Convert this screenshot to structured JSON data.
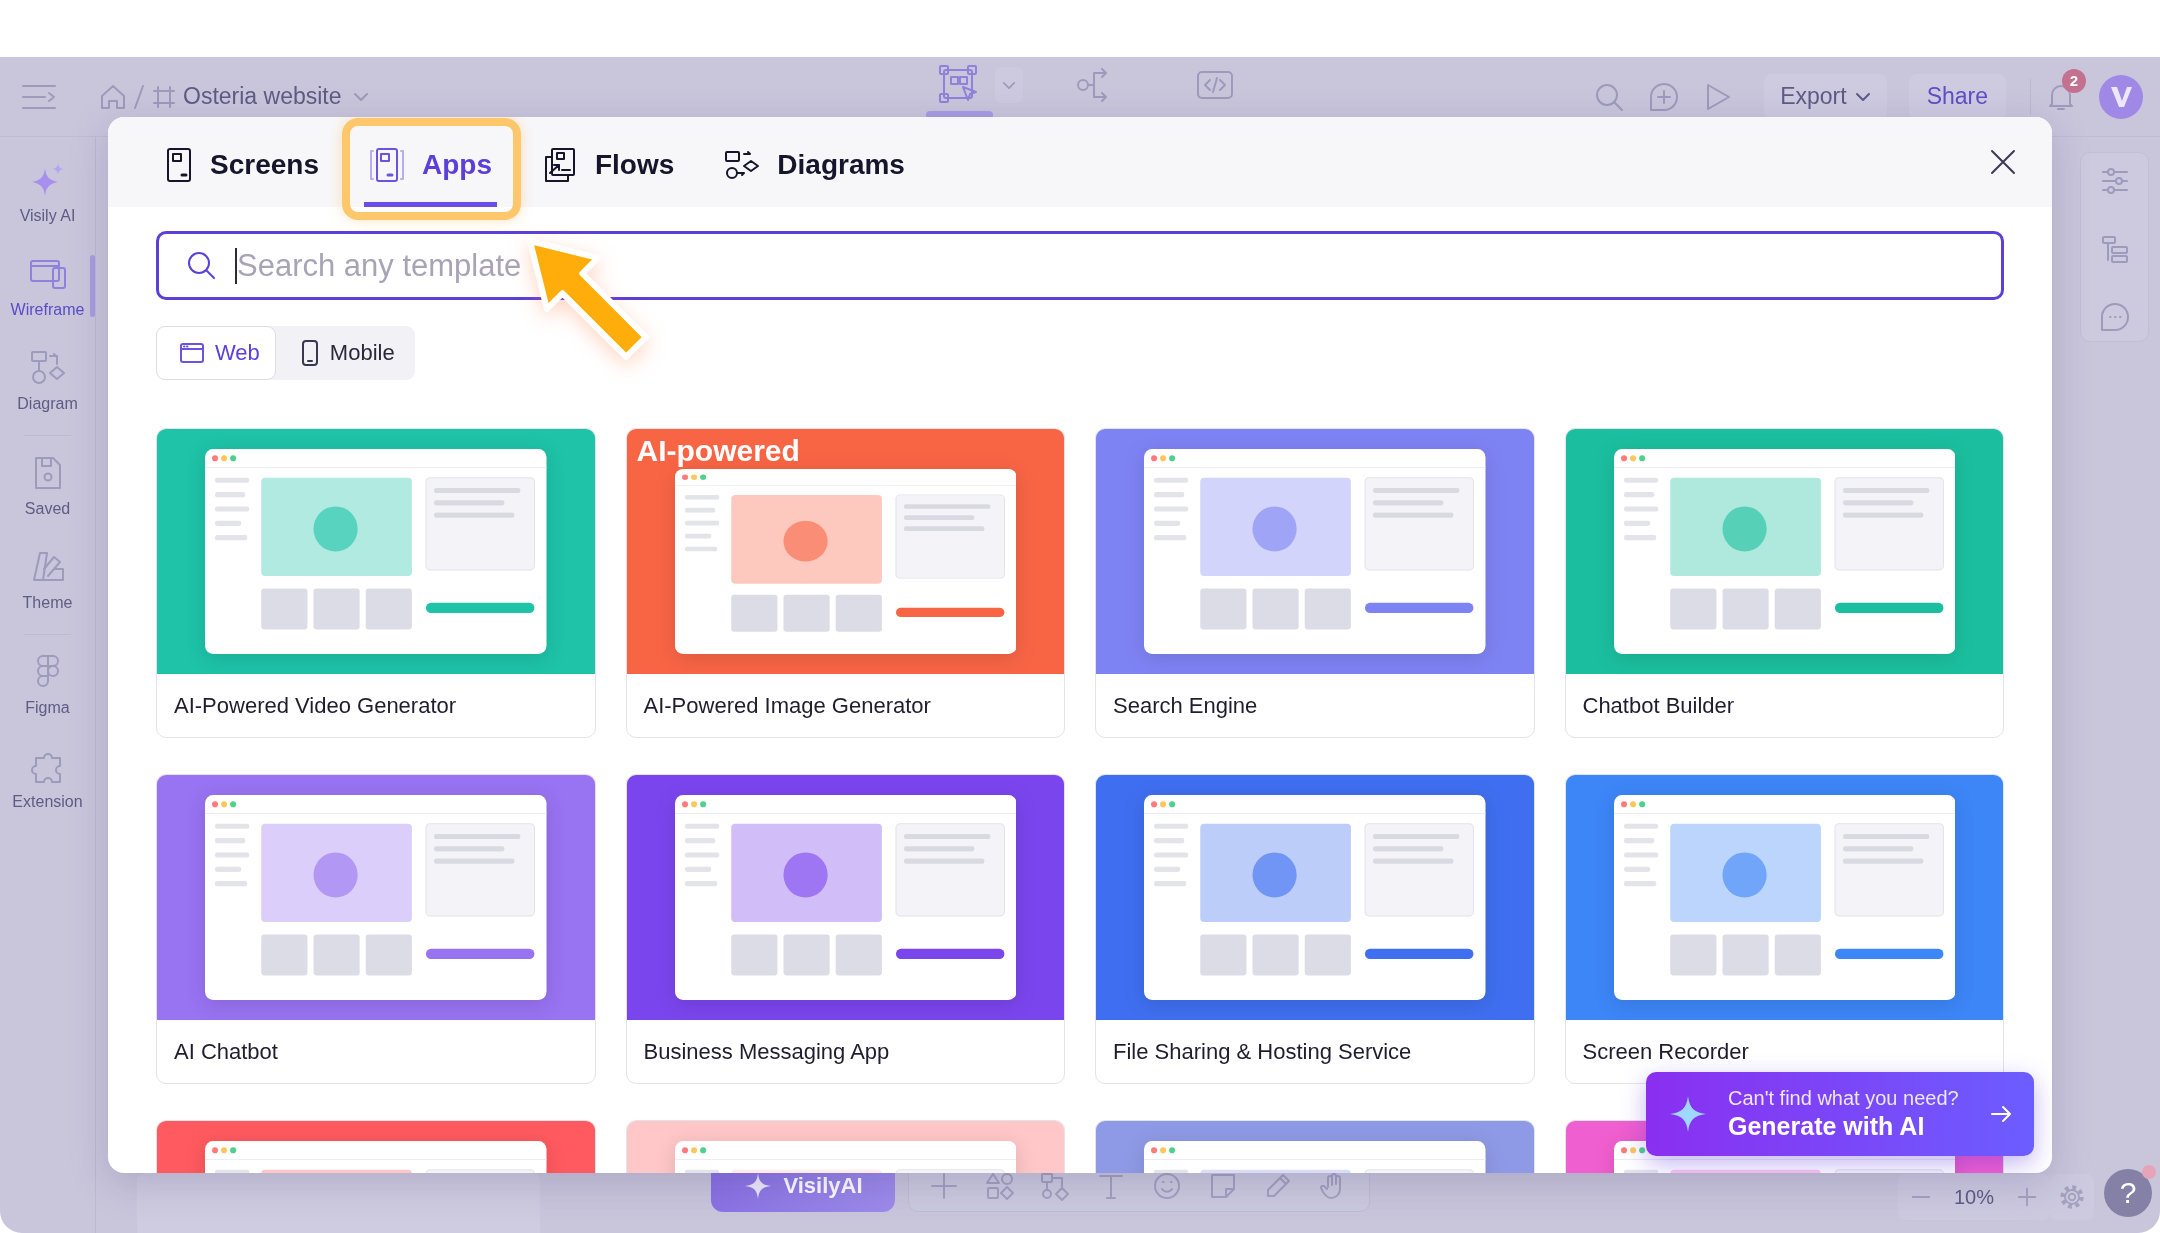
{
  "top_bar": {
    "project": "Osteria website",
    "modes": [
      {
        "kind": "design",
        "selected": true
      },
      {
        "kind": "prototype",
        "selected": false
      },
      {
        "kind": "inspect",
        "selected": false
      }
    ],
    "export": "Export",
    "share": "Share",
    "notification_count": "2"
  },
  "sidebar": {
    "groups": [
      {
        "items": [
          {
            "label": "Visily AI",
            "kind": "ai",
            "selected": false
          },
          {
            "label": "Wireframe",
            "kind": "wireframe",
            "selected": true
          },
          {
            "label": "Diagram",
            "kind": "diagram",
            "selected": false
          }
        ]
      },
      {
        "items": [
          {
            "label": "Saved",
            "kind": "saved",
            "selected": false
          },
          {
            "label": "Theme",
            "kind": "theme",
            "selected": false
          }
        ]
      },
      {
        "items": [
          {
            "label": "Figma",
            "kind": "figma",
            "selected": false
          },
          {
            "label": "Extension",
            "kind": "extension",
            "selected": false
          }
        ]
      }
    ]
  },
  "canvas_toolbar": {
    "ai_button": "VisilyAI",
    "zoom": "10%",
    "help": "?"
  },
  "template_dialog": {
    "tabs": [
      {
        "label": "Screens",
        "kind": "screens",
        "selected": false
      },
      {
        "label": "Apps",
        "kind": "apps",
        "selected": true
      },
      {
        "label": "Flows",
        "kind": "flows",
        "selected": false
      },
      {
        "label": "Diagrams",
        "kind": "diagrams",
        "selected": false
      }
    ],
    "search": {
      "placeholder": "Search any template"
    },
    "platforms": [
      {
        "label": "Web",
        "kind": "web",
        "selected": true
      },
      {
        "label": "Mobile",
        "kind": "mobile",
        "selected": false
      }
    ],
    "templates": [
      {
        "title": "AI-Powered Video Generator",
        "color": "#1ec3a8"
      },
      {
        "title": "AI-Powered Image Generator",
        "color": "#f86545",
        "thumbnail_text": "AI-powered"
      },
      {
        "title": "Search Engine",
        "color": "#7e83f4"
      },
      {
        "title": "Chatbot Builder",
        "color": "#1bbf9f"
      },
      {
        "title": "AI Chatbot",
        "color": "#9873f2"
      },
      {
        "title": "Business Messaging App",
        "color": "#7b45ee"
      },
      {
        "title": "File Sharing & Hosting Service",
        "color": "#3f6ff0"
      },
      {
        "title": "Screen Recorder",
        "color": "#3d86f7"
      },
      {
        "color": "#ff5a5f"
      },
      {
        "color": "#ffc7c7"
      },
      {
        "color": "#8f9ae6"
      },
      {
        "color": "#f05fcf"
      }
    ],
    "ai_prompt": {
      "question": "Can't find what you need?",
      "action": "Generate with AI"
    }
  }
}
